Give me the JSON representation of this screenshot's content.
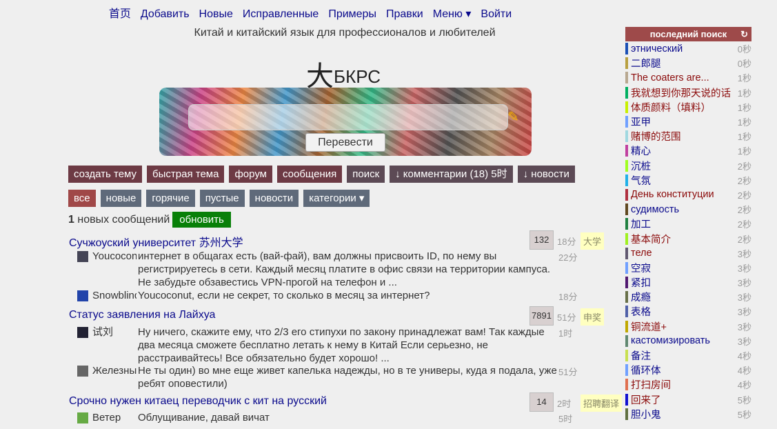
{
  "nav": [
    "首页",
    "Добавить",
    "Новые",
    "Исправленные",
    "Примеры",
    "Правки",
    "Меню ▾",
    "Войти"
  ],
  "subtitle": "Китай и китайский язык для профессионалов и любителей",
  "logo": {
    "hanzi": "大",
    "text": "БКРС"
  },
  "translate_label": "Перевести",
  "row1": [
    "создать тему",
    "быстрая тема",
    "форум",
    "сообщения",
    "поиск",
    "↓ комментарии (18) 5时",
    "↓ новости"
  ],
  "row2": [
    "все",
    "новые",
    "горячие",
    "пустые",
    "новости",
    "категории ▾"
  ],
  "new_count": "1",
  "new_label": " новых сообщений",
  "refresh": "обновить",
  "topics": [
    {
      "title": "Сучжоуский университет 苏州大学",
      "count": "132",
      "age": "18分",
      "tag": "大学",
      "posts": [
        {
          "user": "Youcoconut",
          "text": "интернет в общагах есть (вай-фай), вам должны присвоить ID, по нему вы регистрируетесь в сети. Каждый месяц платите в офис связи на территории кампуса. Не забудьте обзавестись VPN-прогой на телефон и ...",
          "age": "22分",
          "color": "#445"
        },
        {
          "user": "Snowblind",
          "text": "Youcoconut, если не секрет, то сколько в месяц за интернет?",
          "age": "18分",
          "color": "#2244aa"
        }
      ]
    },
    {
      "title": "Статус заявления на Лайхуа",
      "count": "7891",
      "age": "51分",
      "tag": "申奖",
      "posts": [
        {
          "user": "试刘",
          "text": "Ну ничего, скажите ему, что 2/3 его стипухи по закону принадлежат вам! Так каждые два месяца сможете бесплатно летать к нему в Китай Если серьезно, не расстраивайтесь! Все обязательно будет хорошо! ...",
          "age": "1时",
          "color": "#223"
        },
        {
          "user": "Железный",
          "text": "Не ты один) во мне еще живет капелька надежды, но в те универы, куда я подала, уже ребят оповестили)",
          "age": "51分",
          "color": "#666"
        }
      ]
    },
    {
      "title": "Срочно нужен китаец переводчик с кит на русский",
      "count": "14",
      "age": "2时",
      "tag": "招聘翻译",
      "posts": [
        {
          "user": "Ветер",
          "text": "Облущивание, давай вичат",
          "age": "5时",
          "color": "#6a4"
        }
      ]
    }
  ],
  "sidebar": {
    "title": "последний поиск",
    "refresh_icon": "↻",
    "colors": {
      "blue": "#0a0a8c",
      "red": "#8b0a0a"
    },
    "items": [
      [
        "этнический",
        "0秒",
        "#1a4fb5",
        "blue"
      ],
      [
        "二郎腿",
        "0秒",
        "#b8a040",
        "blue"
      ],
      [
        "The coaters are...",
        "1秒",
        "#b8a890",
        "red"
      ],
      [
        "我就想到你那天说的话",
        "1秒",
        "#00b060",
        "red"
      ],
      [
        "体质颜料（填料）",
        "1秒",
        "#c8f000",
        "red"
      ],
      [
        "亚甲",
        "1秒",
        "#70a0ff",
        "blue"
      ],
      [
        "赌博的范围",
        "1秒",
        "#a0d8e0",
        "red"
      ],
      [
        "精心",
        "1秒",
        "#c040a0",
        "blue"
      ],
      [
        "沉桩",
        "2秒",
        "#a0ff20",
        "blue"
      ],
      [
        "气氛",
        "2秒",
        "#20b0e8",
        "blue"
      ],
      [
        "День конституции",
        "2秒",
        "#b03040",
        "red"
      ],
      [
        "судимость",
        "2秒",
        "#604820",
        "blue"
      ],
      [
        "加工",
        "2秒",
        "#208040",
        "blue"
      ],
      [
        "基本简介",
        "2秒",
        "#a0f020",
        "red"
      ],
      [
        "теле",
        "3秒",
        "#605870",
        "red"
      ],
      [
        "空寂",
        "3秒",
        "#70a0ff",
        "blue"
      ],
      [
        "紧扣",
        "3秒",
        "#501870",
        "blue"
      ],
      [
        "成瘾",
        "3秒",
        "#687048",
        "blue"
      ],
      [
        "表格",
        "3秒",
        "#5060a8",
        "blue"
      ],
      [
        "铜流道+",
        "3秒",
        "#c0a800",
        "red"
      ],
      [
        "кастомизировать",
        "3秒",
        "#608870",
        "blue"
      ],
      [
        "备注",
        "4秒",
        "#c8e050",
        "blue"
      ],
      [
        "循环体",
        "4秒",
        "#70a0ff",
        "blue"
      ],
      [
        "打扫房间",
        "4秒",
        "#e07050",
        "red"
      ],
      [
        "回来了",
        "5秒",
        "#1010d0",
        "red"
      ],
      [
        "胆小鬼",
        "5秒",
        "#607040",
        "blue"
      ]
    ]
  }
}
